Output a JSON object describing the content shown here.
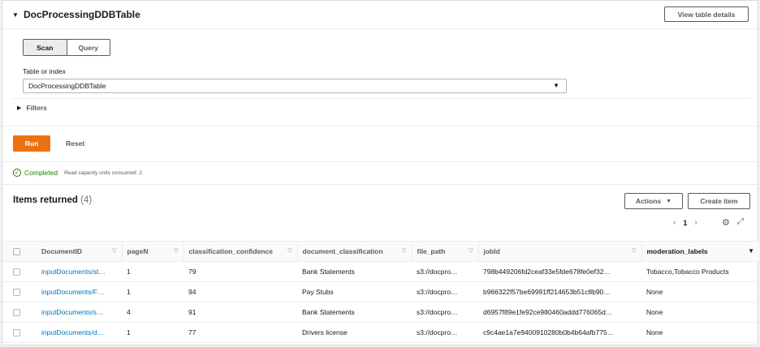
{
  "header": {
    "title": "DocProcessingDDBTable",
    "view_details_label": "View table details"
  },
  "mode_toggle": {
    "scan_label": "Scan",
    "query_label": "Query",
    "selected": "Scan"
  },
  "table_or_index": {
    "label": "Table or index",
    "value": "DocProcessingDDBTable"
  },
  "filters_label": "Filters",
  "actions": {
    "run_label": "Run",
    "reset_label": "Reset"
  },
  "status": {
    "text": "Completed",
    "capacity_text": "Read capacity units consumed: 2"
  },
  "items": {
    "title": "Items returned",
    "count": "(4)",
    "actions_label": "Actions",
    "create_item_label": "Create item",
    "page": "1"
  },
  "columns": [
    "DocumentID",
    "pageN",
    "classification_confidence",
    "document_classification",
    "file_path",
    "jobId",
    "moderation_labels"
  ],
  "rows": [
    [
      "inputDocuments/st…",
      "1",
      "79",
      "Bank Statements",
      "s3://docpro…",
      "798b449206fd2ceaf33e5fde678fe0ef32…",
      "Tobacco,Tobacco Products"
    ],
    [
      "inputDocuments/F…",
      "1",
      "94",
      "Pay Stubs",
      "s3://docpro…",
      "b966322f57be69991ff214653b51c8b90…",
      "None"
    ],
    [
      "inputDocuments/s…",
      "4",
      "91",
      "Bank Statements",
      "s3://docpro…",
      "d6957f89e1fe92ce980460addd776065d…",
      "None"
    ],
    [
      "inputDocuments/d…",
      "1",
      "77",
      "Drivers license",
      "s3://docpro…",
      "c9c4ae1a7e9400910280b0b4b64afb775…",
      "None"
    ]
  ],
  "colors": {
    "accent": "#ec7211",
    "link": "#0073bb",
    "success": "#1d8102"
  }
}
